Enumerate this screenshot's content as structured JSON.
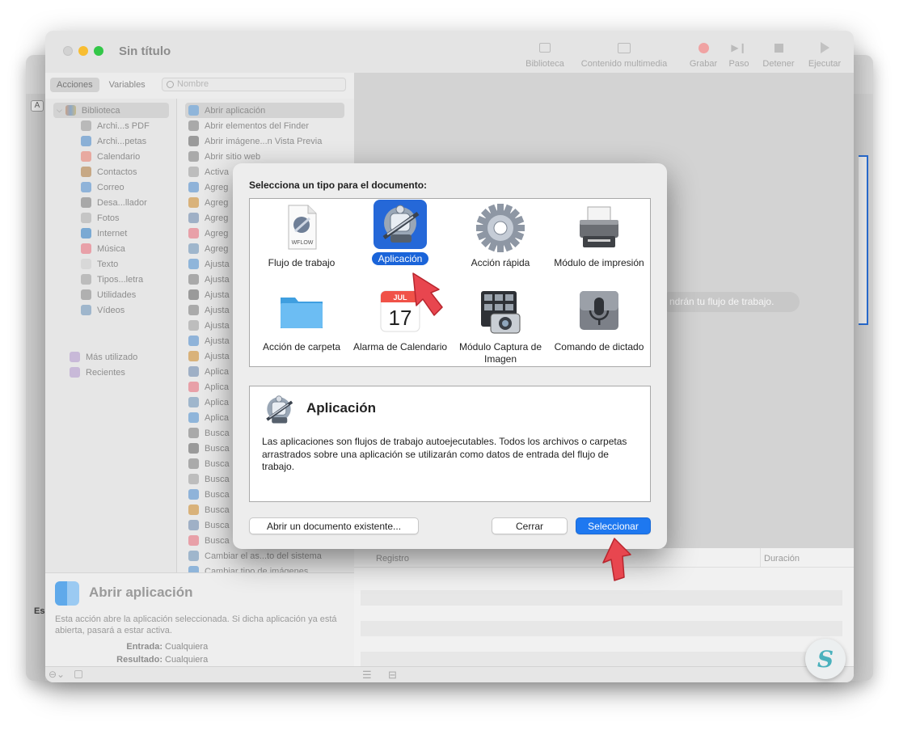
{
  "window": {
    "title": "Sin título",
    "toolbar": [
      {
        "label": "Biblioteca",
        "icon": "library-icon"
      },
      {
        "label": "Contenido multimedia",
        "icon": "media-icon"
      },
      {
        "label": "Grabar",
        "icon": "record-icon"
      },
      {
        "label": "Paso",
        "icon": "step-icon"
      },
      {
        "label": "Detener",
        "icon": "stop-icon"
      },
      {
        "label": "Ejecutar",
        "icon": "run-icon"
      }
    ],
    "tabs": {
      "actions": "Acciones",
      "variables": "Variables"
    },
    "search": {
      "placeholder": "Nombre"
    }
  },
  "library": {
    "root": "Biblioteca",
    "items": [
      "Archi...s PDF",
      "Archi...petas",
      "Calendario",
      "Contactos",
      "Correo",
      "Desa...llador",
      "Fotos",
      "Internet",
      "Música",
      "Texto",
      "Tipos...letra",
      "Utilidades",
      "Vídeos"
    ],
    "extras": [
      "Más utilizado",
      "Recientes"
    ]
  },
  "actions": {
    "items": [
      "Abrir aplicación",
      "Abrir elementos del Finder",
      "Abrir imágene...n Vista Previa",
      "Abrir sitio web",
      "Activa",
      "Agreg",
      "Agreg",
      "Agreg",
      "Agreg",
      "Agreg",
      "Ajusta",
      "Ajusta",
      "Ajusta",
      "Ajusta",
      "Ajusta",
      "Ajusta",
      "Ajusta",
      "Aplica",
      "Aplica",
      "Aplica",
      "Aplica",
      "Busca",
      "Busca",
      "Busca",
      "Busca",
      "Busca",
      "Busca",
      "Busca",
      "Busca",
      "Cambiar el as...to del sistema",
      "Cambiar tipo de imágenes"
    ]
  },
  "workflow": {
    "hint": "ndrán tu flujo de trabajo."
  },
  "log": {
    "col_log": "Registro",
    "col_duration": "Duración"
  },
  "description": {
    "title": "Abrir aplicación",
    "text": "Esta acción abre la aplicación seleccionada. Si dicha aplicación ya está abierta, pasará a estar activa.",
    "input_label": "Entrada:",
    "input_value": "Cualquiera",
    "result_label": "Resultado:",
    "result_value": "Cualquiera"
  },
  "back_window": {
    "tab_letter": "A",
    "side_label": "Es"
  },
  "dialog": {
    "title": "Selecciona un tipo para el documento:",
    "types": [
      {
        "label": "Flujo de trabajo",
        "icon": "workflow-document-icon",
        "file_tag": "WFLOW"
      },
      {
        "label": "Aplicación",
        "icon": "automator-robot-icon",
        "selected": true
      },
      {
        "label": "Acción rápida",
        "icon": "gear-icon"
      },
      {
        "label": "Módulo de impresión",
        "icon": "printer-icon"
      },
      {
        "label": "Acción de carpeta",
        "icon": "folder-icon"
      },
      {
        "label": "Alarma de Calendario",
        "icon": "calendar-icon",
        "cal_month": "JUL",
        "cal_day": "17"
      },
      {
        "label": "Módulo Captura de Imagen",
        "icon": "image-capture-icon"
      },
      {
        "label": "Comando de dictado",
        "icon": "microphone-icon"
      }
    ],
    "info": {
      "title": "Aplicación",
      "text": "Las aplicaciones son flujos de trabajo autoejecutables. Todos los archivos o carpetas arrastrados sobre una aplicación se utilizarán como datos de entrada del flujo de trabajo."
    },
    "buttons": {
      "open_existing": "Abrir un documento existente...",
      "close": "Cerrar",
      "select": "Seleccionar"
    }
  },
  "colors": {
    "accent": "#1e78f0",
    "selection": "#1a64d9",
    "annotation_arrow": "#e8464f"
  }
}
